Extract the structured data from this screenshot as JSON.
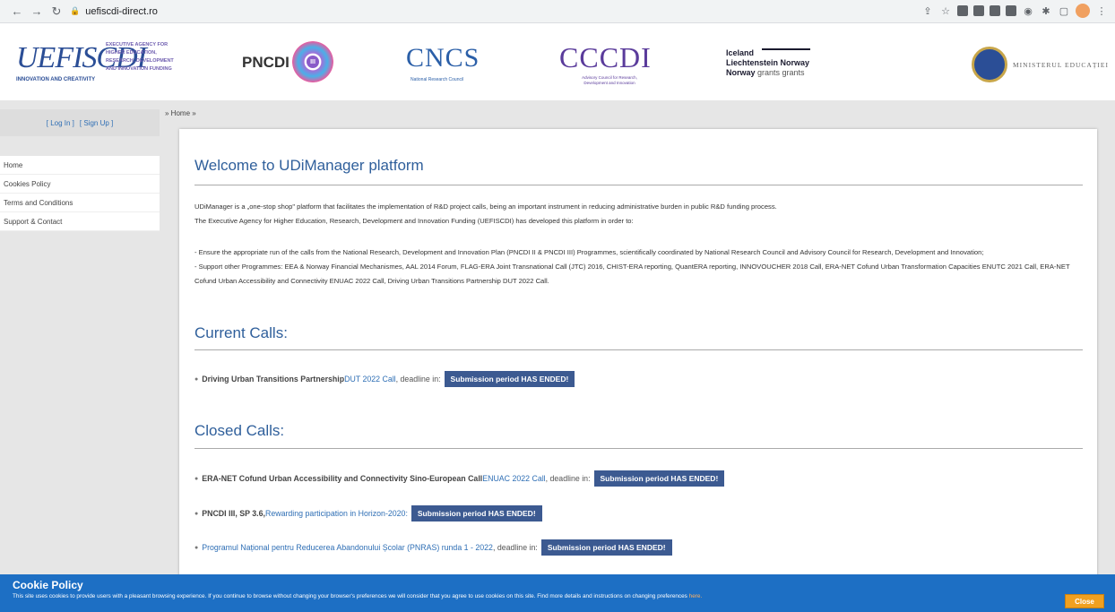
{
  "browser": {
    "url": "uefiscdi-direct.ro"
  },
  "header": {
    "uefiscdi_word": "UEFISCDI",
    "uefiscdi_tagline": "INNOVATION AND CREATIVITY",
    "uefiscdi_desc_lines": [
      "EXECUTIVE AGENCY FOR",
      "HIGHER EDUCATION,",
      "RESEARCH, DEVELOPMENT",
      "AND INNOVATION FUNDING"
    ],
    "pncdi": "PNCDI",
    "pncdi_roman": "III",
    "cncs": "CNCS",
    "cncs_sub": "National Research Council",
    "cccdi": "CCCDI",
    "cccdi_sub": "Advisory Council for Research, Development and Innovation",
    "grants_line1": "Iceland",
    "grants_line2": "Liechtenstein   Norway",
    "grants_line3_bold": "Norway",
    "grants_line3_light": "grants   grants",
    "ministry": "MINISTERUL EDUCAȚIEI"
  },
  "sidebar": {
    "login": "[ Log In ]",
    "signup": "[ Sign Up ]",
    "menu": [
      "Home",
      "Cookies Policy",
      "Terms and Conditions",
      "Support & Contact"
    ]
  },
  "breadcrumb": "» Home »",
  "main": {
    "title": "Welcome to UDiManager platform",
    "intro1": "UDiManager is a „one-stop shop\" platform that facilitates the implementation of R&D project calls, being an important instrument in reducing administrative burden in public R&D funding process.",
    "intro2": "The Executive Agency for Higher Education, Research, Development and Innovation Funding (UEFISCDI) has developed this platform in order to:",
    "bullet1": "- Ensure the appropriate run of the calls from the National Research, Development and Innovation Plan (PNCDI II & PNCDI III) Programmes, scientifically coordinated by National Research Council and Advisory Council for Research, Development and Innovation;",
    "bullet2": "- Support other Programmes: EEA & Norway Financial Mechanismes, AAL 2014 Forum, FLAG-ERA Joint Transnational Call (JTC) 2016, CHIST-ERA reporting, QuantERA reporting, INNOVOUCHER 2018 Call, ERA-NET Cofund Urban Transformation Capacities ENUTC 2021 Call, ERA-NET Cofund Urban Accessibility and Connectivity ENUAC 2022 Call, Driving Urban Transitions Partnership DUT 2022 Call.",
    "current_title": "Current Calls:",
    "closed_title": "Closed Calls:",
    "current_calls": [
      {
        "prefix": "Driving Urban Transitions Partnership ",
        "link": "DUT 2022 Call",
        "suffix": ", deadline in:",
        "badge": "Submission period HAS ENDED!"
      }
    ],
    "closed_calls": [
      {
        "prefix": "ERA-NET Cofund Urban Accessibility and Connectivity Sino-European Call ",
        "link": "ENUAC 2022 Call",
        "suffix": ", deadline in:",
        "badge": "Submission period HAS ENDED!"
      },
      {
        "prefix": "PNCDI III, SP 3.6, ",
        "link": "Rewarding participation in Horizon-2020:",
        "suffix": "",
        "badge": "Submission period HAS ENDED!"
      },
      {
        "prefix": "",
        "link": "Programul Național pentru Reducerea Abandonului Școlar (PNRAS) runda 1 - 2022",
        "suffix": ", deadline in:",
        "badge": "Submission period HAS ENDED!"
      }
    ]
  },
  "cookie": {
    "title": "Cookie Policy",
    "text": "This site uses cookies to provide users with a pleasant browsing experience. If you continue to browse without changing your browser's preferences we will consider that you agree to use cookies on this site. Find more details and instructions on changing preferences ",
    "link": "here.",
    "close": "Close"
  }
}
